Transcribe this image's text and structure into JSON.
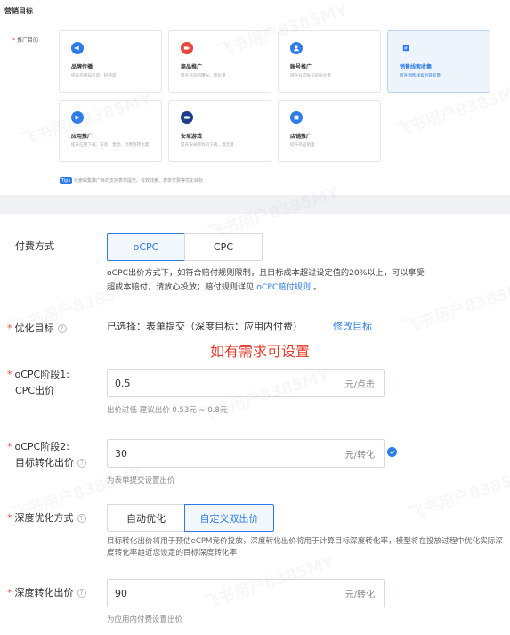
{
  "section_title": "营销目标",
  "promo_goal_label": "推广目的",
  "cards": [
    {
      "title": "品牌传播",
      "desc": "提升品牌知名度、好感度",
      "icon": "megaphone-icon"
    },
    {
      "title": "商品推广",
      "desc": "提升商品的曝光、转化量",
      "icon": "video-icon"
    },
    {
      "title": "账号推广",
      "desc": "提升抖音账号的粉丝量",
      "icon": "user-icon"
    },
    {
      "title": "销售线索收集",
      "desc": "提升销售线索的获取量",
      "icon": "form-icon"
    },
    {
      "title": "应用推广",
      "desc": "提升应用下载、安装、激活、付费等转化量",
      "icon": "app-icon"
    },
    {
      "title": "安卓游戏",
      "desc": "提升安卓游戏的下载、激活量",
      "icon": "gamepad-icon"
    },
    {
      "title": "店铺推广",
      "desc": "提升商品销量",
      "icon": "store-icon"
    }
  ],
  "tips": {
    "tag": "Tips",
    "text": "线索收集推广目的支持表单提交、有效线索、表单付费等优化目标"
  },
  "billing": {
    "label": "付费方式",
    "options": [
      "oCPC",
      "CPC"
    ],
    "selected": "oCPC",
    "desc_prefix": "oCPC出价方式下，如符合赔付规则限制，且目标成本超过设定值的20%以上，可以享受超成本赔付，请放心投放；赔付规则详见",
    "desc_link": "oCPC赔付规则",
    "desc_suffix": "。"
  },
  "optimize": {
    "label": "优化目标",
    "value": "已选择：表单提交（深度目标：应用内付费）",
    "action": "修改目标"
  },
  "note": "如有需求可设置",
  "stage1": {
    "label_line1": "oCPC阶段1:",
    "label_line2": "CPC出价",
    "value": "0.5",
    "unit": "元/点击",
    "hint": "出价过低 建议出价 0.53元 ~ 0.8元"
  },
  "stage2": {
    "label_line1": "oCPC阶段2:",
    "label_line2": "目标转化出价",
    "value": "30",
    "unit": "元/转化",
    "hint": "为表单提交设置出价"
  },
  "deep_mode": {
    "label": "深度优化方式",
    "options": [
      "自动优化",
      "自定义双出价"
    ],
    "selected": "自定义双出价",
    "desc": "目标转化出价将用于预估eCPM竞价投放，深度转化出价将用于计算目标深度转化率，模型将在投放过程中优化实际深度转化率趋近您设定的目标深度转化率"
  },
  "deep_bid": {
    "label": "深度转化出价",
    "value": "90",
    "unit": "元/转化",
    "hint": "为应用内付费设置出价"
  },
  "watermark": "飞书用户8385MY",
  "colors": {
    "accent": "#2f7ce8",
    "required": "#e84a3c",
    "note": "#e53b2c"
  }
}
